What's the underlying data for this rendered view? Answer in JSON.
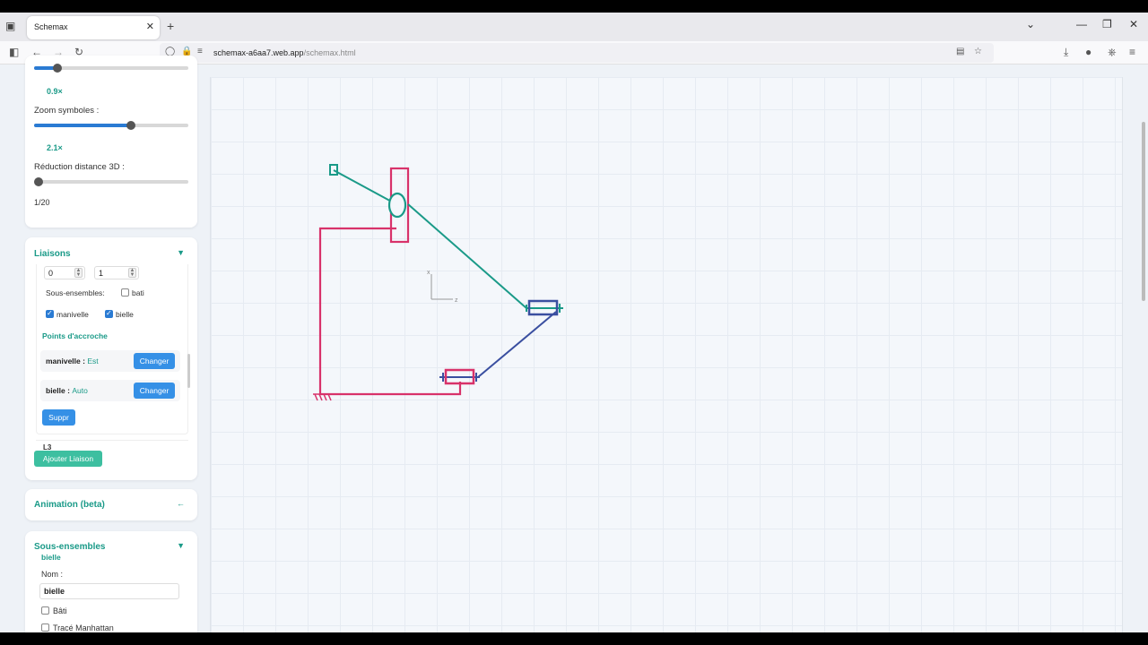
{
  "browser": {
    "tab_title": "Schemax",
    "url_host": "schemax-a6aa7.web.app",
    "url_path": "/schemax.html"
  },
  "display": {
    "scale_value": "0.9×",
    "scale_level": 0.15,
    "zoom_label": "Zoom symboles :",
    "zoom_level": 0.63,
    "zoom_value": "2.1×",
    "distance_label": "Réduction distance 3D :",
    "distance_level": 0.0,
    "distance_value": "1/20"
  },
  "liaisons": {
    "title": "Liaisons",
    "toggle": "▼",
    "num_a": "0",
    "num_b": "1",
    "sous_ensembles_label": "Sous-ensembles:",
    "bati_label": "bati",
    "manivelle_label": "manivelle",
    "bielle_label": "bielle",
    "points_title": "Points d'accroche",
    "point1_name": "manivelle :",
    "point1_value": "Est",
    "point2_name": "bielle :",
    "point2_value": "Auto",
    "changer_label": "Changer",
    "suppr_label": "Suppr",
    "next_item": "L3",
    "add_label": "Ajouter Liaison"
  },
  "animation": {
    "title": "Animation (beta)",
    "toggle": "←"
  },
  "sous_ensembles": {
    "title": "Sous-ensembles",
    "toggle": "▼",
    "group_name": "bielle",
    "nom_label": "Nom :",
    "nom_value": "bielle",
    "bati_label": "Bâti",
    "manhattan_label": "Tracé Manhattan"
  },
  "canvas": {
    "axis_x": "x",
    "axis_z": "z"
  },
  "colors": {
    "teal": "#1a9a88",
    "crimson": "#d8326a",
    "navy": "#3a4fa0"
  }
}
